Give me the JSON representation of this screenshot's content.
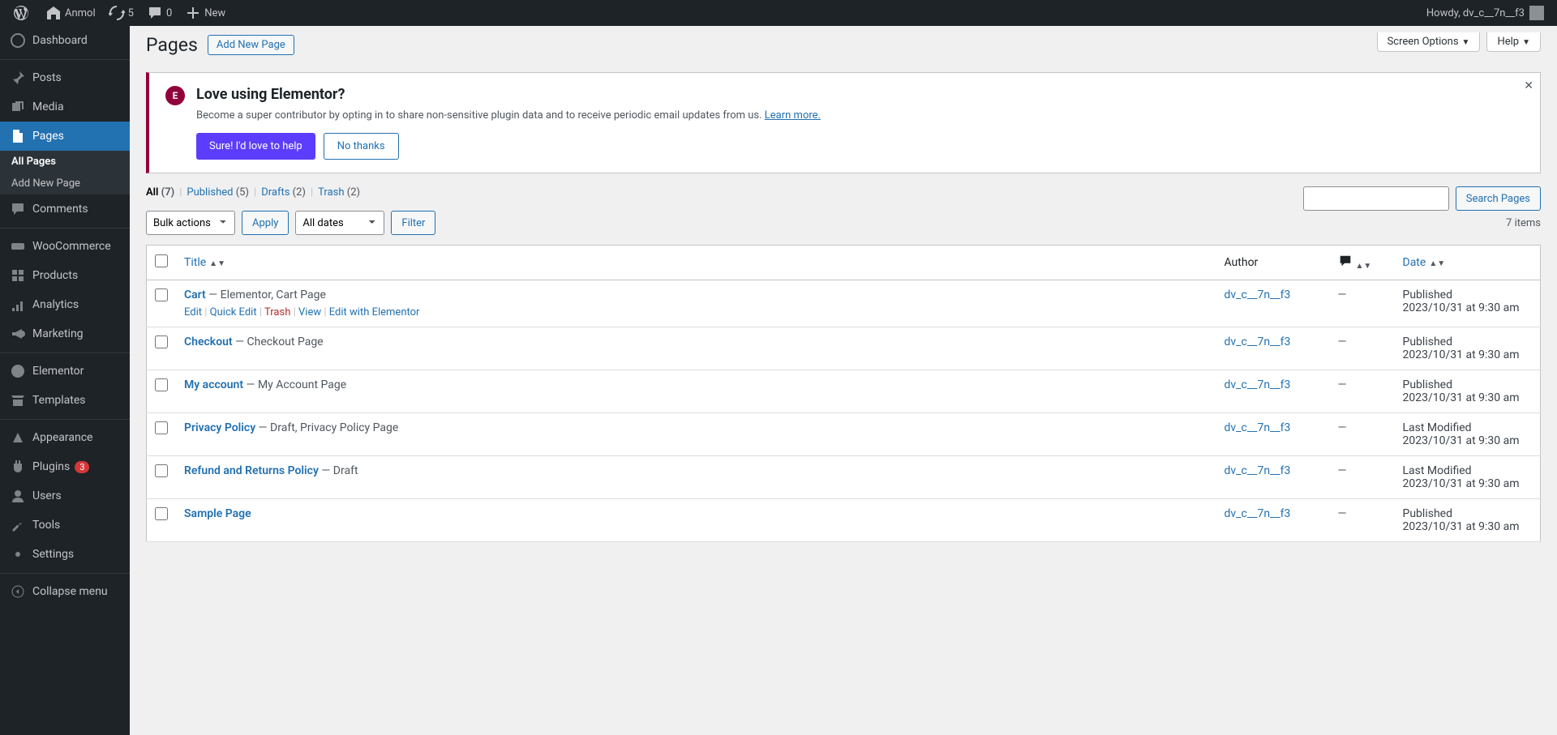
{
  "adminbar": {
    "site_name": "Anmol",
    "updates": "5",
    "comments": "0",
    "new_label": "New",
    "howdy": "Howdy, dv_c__7n__f3"
  },
  "sidebar": {
    "dashboard": "Dashboard",
    "posts": "Posts",
    "media": "Media",
    "pages": "Pages",
    "all_pages": "All Pages",
    "add_new_page": "Add New Page",
    "comments": "Comments",
    "woocommerce": "WooCommerce",
    "products": "Products",
    "analytics": "Analytics",
    "marketing": "Marketing",
    "elementor": "Elementor",
    "templates": "Templates",
    "appearance": "Appearance",
    "plugins": "Plugins",
    "plugins_badge": "3",
    "users": "Users",
    "tools": "Tools",
    "settings": "Settings",
    "collapse": "Collapse menu"
  },
  "page": {
    "title": "Pages",
    "add_new": "Add New Page",
    "screen_options": "Screen Options",
    "help": "Help"
  },
  "notice": {
    "title": "Love using Elementor?",
    "text": "Become a super contributor by opting in to share non-sensitive plugin data and to receive periodic email updates from us. ",
    "learn_more": "Learn more.",
    "btn_yes": "Sure! I'd love to help",
    "btn_no": "No thanks"
  },
  "filters": {
    "all": "All",
    "all_count": "(7)",
    "published": "Published",
    "published_count": "(5)",
    "drafts": "Drafts",
    "drafts_count": "(2)",
    "trash": "Trash",
    "trash_count": "(2)"
  },
  "tablenav": {
    "bulk": "Bulk actions",
    "apply": "Apply",
    "dates": "All dates",
    "filter": "Filter",
    "search": "Search Pages",
    "item_count": "7 items"
  },
  "table": {
    "th_title": "Title",
    "th_author": "Author",
    "th_date": "Date"
  },
  "rows": [
    {
      "title": "Cart",
      "suffix": " — Elementor, Cart Page",
      "author": "dv_c__7n__f3",
      "status": "Published",
      "date": "2023/10/31 at 9:30 am",
      "show_actions": true
    },
    {
      "title": "Checkout",
      "suffix": " — Checkout Page",
      "author": "dv_c__7n__f3",
      "status": "Published",
      "date": "2023/10/31 at 9:30 am"
    },
    {
      "title": "My account",
      "suffix": " — My Account Page",
      "author": "dv_c__7n__f3",
      "status": "Published",
      "date": "2023/10/31 at 9:30 am"
    },
    {
      "title": "Privacy Policy",
      "suffix": " — Draft, Privacy Policy Page",
      "author": "dv_c__7n__f3",
      "status": "Last Modified",
      "date": "2023/10/31 at 9:30 am"
    },
    {
      "title": "Refund and Returns Policy",
      "suffix": " — Draft",
      "author": "dv_c__7n__f3",
      "status": "Last Modified",
      "date": "2023/10/31 at 9:30 am"
    },
    {
      "title": "Sample Page",
      "suffix": "",
      "author": "dv_c__7n__f3",
      "status": "Published",
      "date": "2023/10/31 at 9:30 am"
    }
  ],
  "actions": {
    "edit": "Edit",
    "quick_edit": "Quick Edit",
    "trash": "Trash",
    "view": "View",
    "edit_elementor": "Edit with Elementor"
  }
}
